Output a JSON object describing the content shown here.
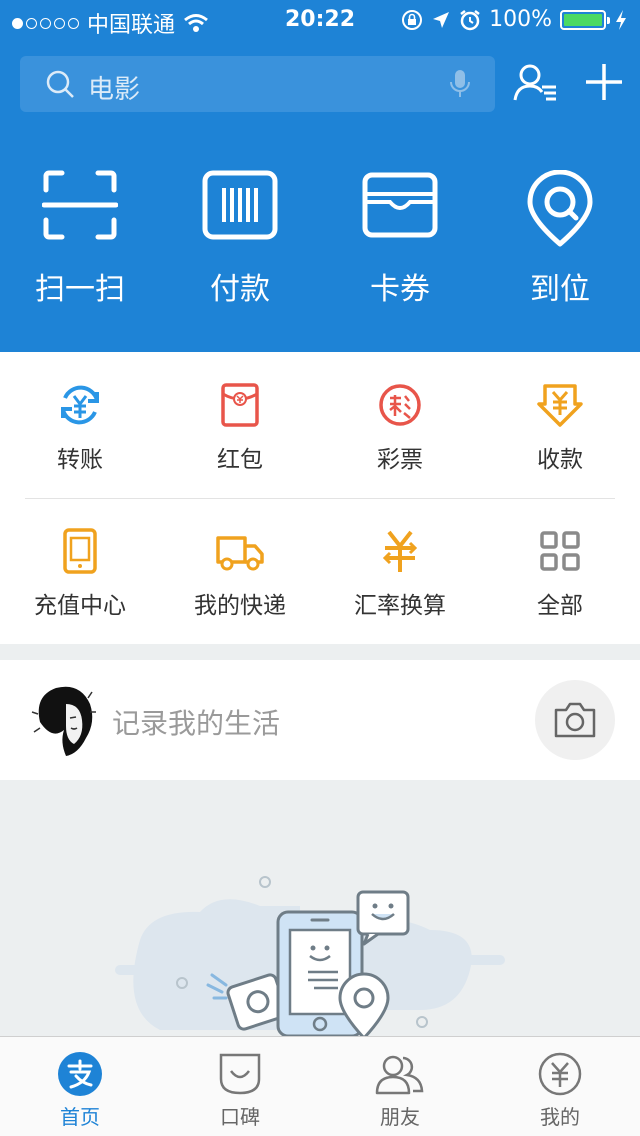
{
  "status_bar": {
    "carrier": "中国联通",
    "time": "20:22",
    "battery": "100%"
  },
  "search": {
    "placeholder": "电影"
  },
  "quick_actions": [
    {
      "label": "扫一扫",
      "icon": "scan-icon"
    },
    {
      "label": "付款",
      "icon": "barcode-icon"
    },
    {
      "label": "卡券",
      "icon": "wallet-icon"
    },
    {
      "label": "到位",
      "icon": "location-icon"
    }
  ],
  "services": [
    {
      "label": "转账",
      "icon": "transfer-icon",
      "color": "#2a96e6"
    },
    {
      "label": "红包",
      "icon": "red-envelope-icon",
      "color": "#e8554a"
    },
    {
      "label": "彩票",
      "icon": "lottery-icon",
      "color": "#e8554a"
    },
    {
      "label": "收款",
      "icon": "receive-money-icon",
      "color": "#f0a21e"
    },
    {
      "label": "充值中心",
      "icon": "phone-recharge-icon",
      "color": "#f0a21e"
    },
    {
      "label": "我的快递",
      "icon": "delivery-truck-icon",
      "color": "#f0a21e"
    },
    {
      "label": "汇率换算",
      "icon": "exchange-rate-icon",
      "color": "#f0a21e"
    },
    {
      "label": "全部",
      "icon": "grid-icon",
      "color": "#8a8a8a"
    }
  ],
  "life_post": {
    "prompt": "记录我的生活"
  },
  "tabs": [
    {
      "label": "首页",
      "icon": "alipay-home-icon",
      "active": true
    },
    {
      "label": "口碑",
      "icon": "koubei-icon",
      "active": false
    },
    {
      "label": "朋友",
      "icon": "friends-icon",
      "active": false
    },
    {
      "label": "我的",
      "icon": "my-account-icon",
      "active": false
    }
  ],
  "colors": {
    "brand_blue": "#1e83d6",
    "battery_green": "#4cd964"
  }
}
